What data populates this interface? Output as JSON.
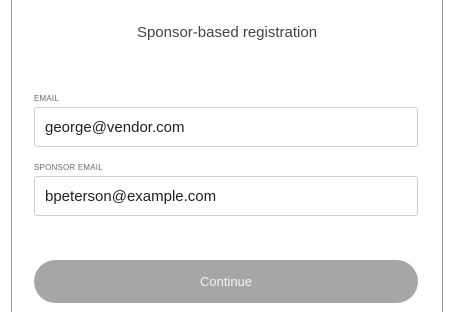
{
  "form": {
    "title": "Sponsor-based registration",
    "email": {
      "label": "EMAIL",
      "value": "george@vendor.com"
    },
    "sponsor_email": {
      "label": "SPONSOR EMAIL",
      "value": "bpeterson@example.com"
    },
    "continue_label": "Continue"
  }
}
